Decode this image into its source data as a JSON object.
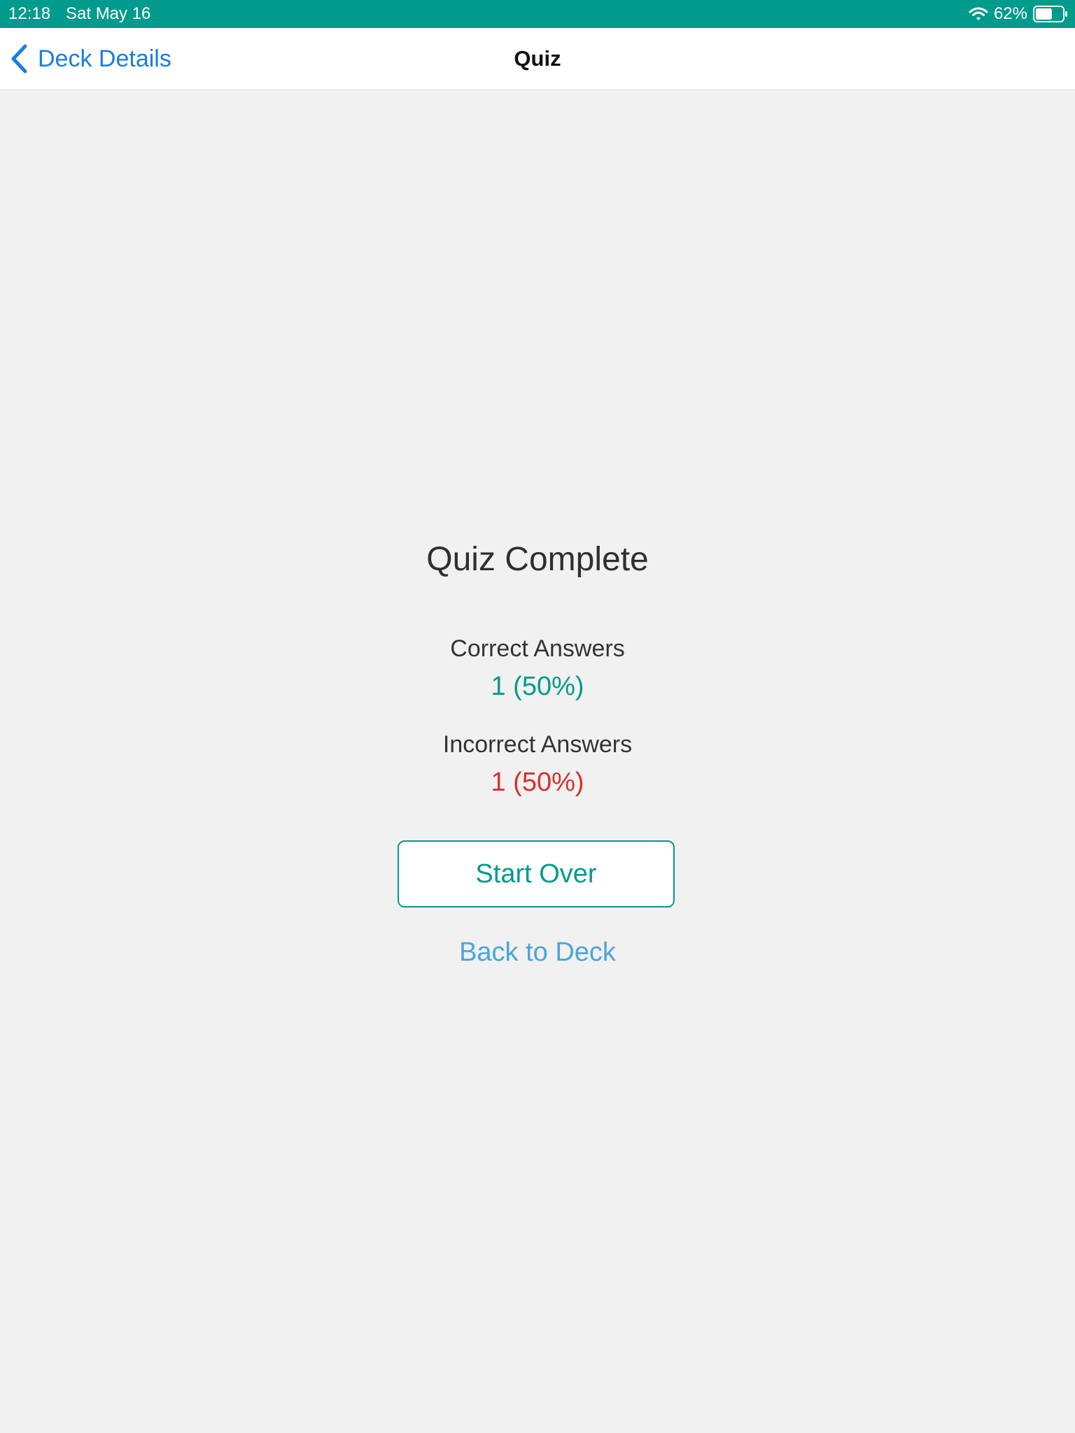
{
  "status_bar": {
    "time": "12:18",
    "date": "Sat May 16",
    "battery_percent": "62%",
    "battery_level": 0.62,
    "icons": [
      "wifi-icon",
      "battery-icon"
    ],
    "background_color": "#009b8c"
  },
  "nav": {
    "back_label": "Deck Details",
    "back_icon": "chevron-left-icon",
    "title": "Quiz"
  },
  "result": {
    "title": "Quiz Complete",
    "correct_label": "Correct Answers",
    "correct_value": "1 (50%)",
    "incorrect_label": "Incorrect Answers",
    "incorrect_value": "1 (50%)"
  },
  "actions": {
    "start_over_label": "Start Over",
    "back_to_deck_label": "Back to Deck"
  },
  "colors": {
    "accent": "#009b8c",
    "correct": "#009b8c",
    "incorrect": "#d9302c",
    "link": "#4aa6d8",
    "nav_link": "#1a7de0"
  }
}
